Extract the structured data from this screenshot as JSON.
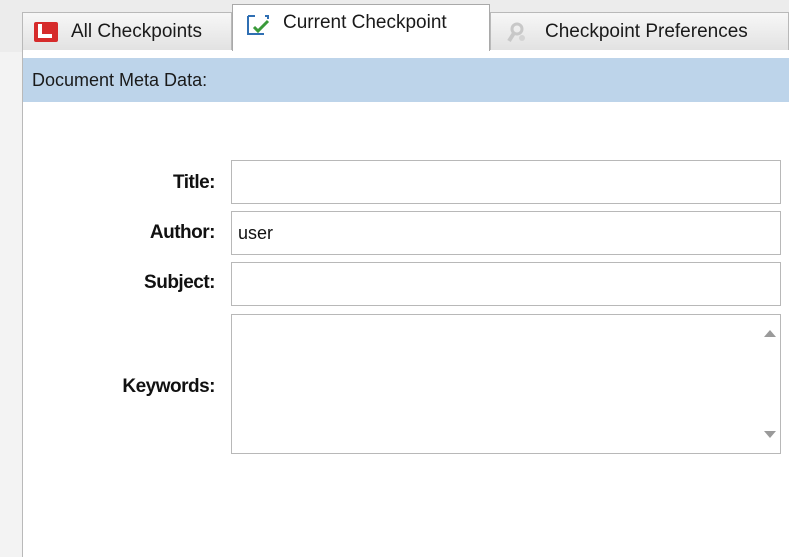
{
  "tabs": [
    {
      "label": "All Checkpoints",
      "icon": "all-checkpoints-icon"
    },
    {
      "label": "Current Checkpoint",
      "icon": "current-checkpoint-icon",
      "selected": true
    },
    {
      "label": "Checkpoint Preferences",
      "icon": "preferences-icon"
    }
  ],
  "section": {
    "header": "Document Meta Data:"
  },
  "fields": {
    "title": {
      "label": "Title:",
      "value": ""
    },
    "author": {
      "label": "Author:",
      "value": "user"
    },
    "subject": {
      "label": "Subject:",
      "value": ""
    },
    "keywords": {
      "label": "Keywords:",
      "value": ""
    }
  },
  "colors": {
    "header_bg": "#bdd4ea",
    "all_checkpoints_icon": "#d62b2b",
    "current_checkpoint_icon": "#3a9a3a"
  }
}
